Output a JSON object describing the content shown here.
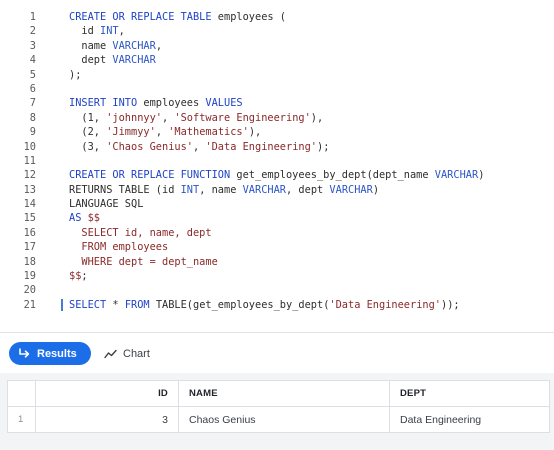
{
  "editor": {
    "lines": [
      {
        "no": "1",
        "tokens": [
          {
            "t": "kw",
            "v": "CREATE OR REPLACE TABLE "
          },
          {
            "t": "plain",
            "v": "employees ("
          }
        ]
      },
      {
        "no": "2",
        "tokens": [
          {
            "t": "plain",
            "v": "  id "
          },
          {
            "t": "ty",
            "v": "INT"
          },
          {
            "t": "plain",
            "v": ","
          }
        ]
      },
      {
        "no": "3",
        "tokens": [
          {
            "t": "plain",
            "v": "  name "
          },
          {
            "t": "ty",
            "v": "VARCHAR"
          },
          {
            "t": "plain",
            "v": ","
          }
        ]
      },
      {
        "no": "4",
        "tokens": [
          {
            "t": "plain",
            "v": "  dept "
          },
          {
            "t": "ty",
            "v": "VARCHAR"
          }
        ]
      },
      {
        "no": "5",
        "tokens": [
          {
            "t": "plain",
            "v": ");"
          }
        ]
      },
      {
        "no": "6",
        "tokens": []
      },
      {
        "no": "7",
        "tokens": [
          {
            "t": "kw",
            "v": "INSERT INTO "
          },
          {
            "t": "plain",
            "v": "employees "
          },
          {
            "t": "kw",
            "v": "VALUES"
          }
        ]
      },
      {
        "no": "8",
        "tokens": [
          {
            "t": "plain",
            "v": "  (1, "
          },
          {
            "t": "str",
            "v": "'johnnyy'"
          },
          {
            "t": "plain",
            "v": ", "
          },
          {
            "t": "str",
            "v": "'Software Engineering'"
          },
          {
            "t": "plain",
            "v": "),"
          }
        ]
      },
      {
        "no": "9",
        "tokens": [
          {
            "t": "plain",
            "v": "  (2, "
          },
          {
            "t": "str",
            "v": "'Jimmyy'"
          },
          {
            "t": "plain",
            "v": ", "
          },
          {
            "t": "str",
            "v": "'Mathematics'"
          },
          {
            "t": "plain",
            "v": "),"
          }
        ]
      },
      {
        "no": "10",
        "tokens": [
          {
            "t": "plain",
            "v": "  (3, "
          },
          {
            "t": "str",
            "v": "'Chaos Genius'"
          },
          {
            "t": "plain",
            "v": ", "
          },
          {
            "t": "str",
            "v": "'Data Engineering'"
          },
          {
            "t": "plain",
            "v": ");"
          }
        ]
      },
      {
        "no": "11",
        "tokens": []
      },
      {
        "no": "12",
        "tokens": [
          {
            "t": "kw",
            "v": "CREATE OR REPLACE FUNCTION "
          },
          {
            "t": "plain",
            "v": "get_employees_by_dept(dept_name "
          },
          {
            "t": "ty",
            "v": "VARCHAR"
          },
          {
            "t": "plain",
            "v": ")"
          }
        ]
      },
      {
        "no": "13",
        "tokens": [
          {
            "t": "plain",
            "v": "RETURNS TABLE (id "
          },
          {
            "t": "ty",
            "v": "INT"
          },
          {
            "t": "plain",
            "v": ", name "
          },
          {
            "t": "ty",
            "v": "VARCHAR"
          },
          {
            "t": "plain",
            "v": ", dept "
          },
          {
            "t": "ty",
            "v": "VARCHAR"
          },
          {
            "t": "plain",
            "v": ")"
          }
        ]
      },
      {
        "no": "14",
        "tokens": [
          {
            "t": "plain",
            "v": "LANGUAGE SQL"
          }
        ]
      },
      {
        "no": "15",
        "tokens": [
          {
            "t": "kw",
            "v": "AS "
          },
          {
            "t": "str",
            "v": "$$"
          }
        ]
      },
      {
        "no": "16",
        "tokens": [
          {
            "t": "str",
            "v": "  SELECT id, name, dept"
          }
        ]
      },
      {
        "no": "17",
        "tokens": [
          {
            "t": "str",
            "v": "  FROM employees"
          }
        ]
      },
      {
        "no": "18",
        "tokens": [
          {
            "t": "str",
            "v": "  WHERE dept = dept_name"
          }
        ]
      },
      {
        "no": "19",
        "tokens": [
          {
            "t": "str",
            "v": "$$"
          },
          {
            "t": "plain",
            "v": ";"
          }
        ]
      },
      {
        "no": "20",
        "tokens": []
      },
      {
        "no": "21",
        "tokens": [
          {
            "t": "kw",
            "v": "SELECT "
          },
          {
            "t": "plain",
            "v": "* "
          },
          {
            "t": "kw",
            "v": "FROM "
          },
          {
            "t": "plain",
            "v": "TABLE(get_employees_by_dept("
          },
          {
            "t": "str",
            "v": "'Data Engineering'"
          },
          {
            "t": "plain",
            "v": "));"
          }
        ],
        "active": true
      }
    ]
  },
  "toolbar": {
    "results_label": "Results",
    "chart_label": "Chart",
    "results_color": "#1c6ee8"
  },
  "grid": {
    "headers": [
      "ID",
      "NAME",
      "DEPT"
    ],
    "rows": [
      {
        "rownum": "1",
        "id": "3",
        "name": "Chaos Genius",
        "dept": "Data Engineering"
      }
    ]
  }
}
